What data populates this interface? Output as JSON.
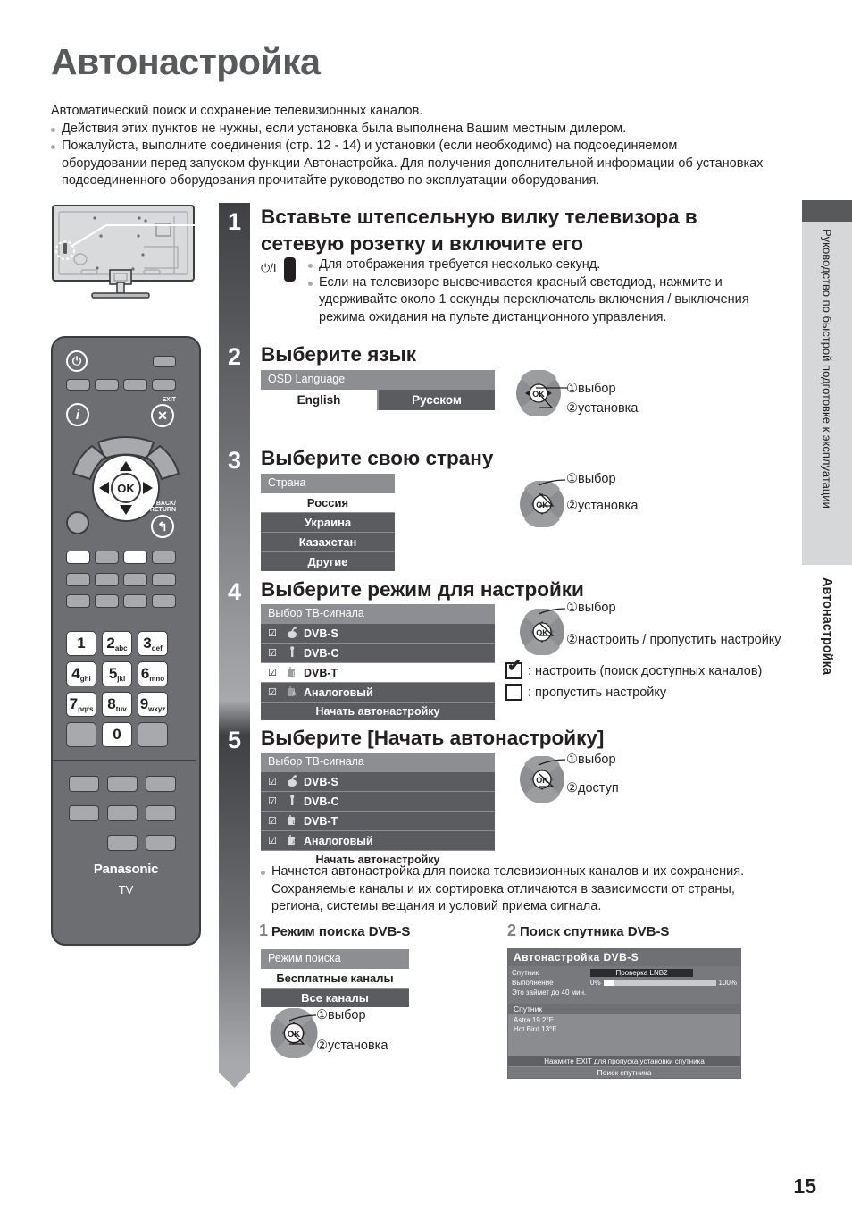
{
  "page": {
    "title": "Автонастройка",
    "number": "15"
  },
  "intro": {
    "lead": "Автоматический поиск и сохранение телевизионных каналов.",
    "bullets": [
      "Действия этих пунктов не нужны, если установка была выполнена Вашим местным дилером.",
      "Пожалуйста, выполните соединения (стр. 12 - 14) и установки (если необходимо) на подсоединяемом оборудовании перед запуском функции Автонастройка. Для получения дополнительной информации об установках подсоединенного оборудования прочитайте руководство по эксплуатации оборудования."
    ]
  },
  "steps": [
    {
      "num": "1",
      "heading": "Вставьте штепсельную вилку телевизора в сетевую розетку и включите его",
      "power_label": "⏻/I",
      "bullets": [
        "Для отображения требуется несколько секунд.",
        "Если на телевизоре высвечивается красный светодиод, нажмите и удерживайте около 1 секунды переключатель включения / выключения режима ожидания на пульте дистанционного управления."
      ]
    },
    {
      "num": "2",
      "heading": "Выберите язык",
      "osd": {
        "title": "OSD Language",
        "options": [
          "English",
          "Русском"
        ],
        "selected": "English"
      },
      "callouts": [
        "①выбор",
        "②установка"
      ],
      "wheel": "left-right"
    },
    {
      "num": "3",
      "heading": "Выберите свою страну",
      "osd": {
        "title": "Страна",
        "rows": [
          "Россия",
          "Украина",
          "Казахстан",
          "Другие"
        ],
        "selected": "Россия"
      },
      "callouts": [
        "①выбор",
        "②установка"
      ],
      "wheel": "up-down"
    },
    {
      "num": "4",
      "heading": "Выберите режим для настройки",
      "osd": {
        "title": "Выбор ТВ-сигнала",
        "rows": [
          {
            "label": "DVB-S",
            "checked": true,
            "icon": "satellite-icon"
          },
          {
            "label": "DVB-C",
            "checked": true,
            "icon": "cable-icon"
          },
          {
            "label": "DVB-T",
            "checked": true,
            "icon": "antenna-terrestrial-icon"
          },
          {
            "label": "Аналоговый",
            "checked": true,
            "icon": "antenna-analogue-icon"
          }
        ],
        "selected": "DVB-T",
        "start_label": "Начать автонастройку"
      },
      "callouts": [
        "①выбор",
        "②настроить / пропустить настройку"
      ],
      "wheel": "up-down",
      "legend": [
        {
          "state": "checked",
          "text": ": настроить (поиск доступных каналов)"
        },
        {
          "state": "empty",
          "text": ": пропустить настройку"
        }
      ]
    },
    {
      "num": "5",
      "heading": "Выберите [Начать автонастройку]",
      "osd": {
        "title": "Выбор ТВ-сигнала",
        "rows": [
          {
            "label": "DVB-S",
            "checked": true,
            "icon": "satellite-icon"
          },
          {
            "label": "DVB-C",
            "checked": true,
            "icon": "cable-icon"
          },
          {
            "label": "DVB-T",
            "checked": true,
            "icon": "antenna-terrestrial-icon"
          },
          {
            "label": "Аналоговый",
            "checked": true,
            "icon": "antenna-analogue-icon"
          }
        ],
        "selected": "Начать автонастройку",
        "start_label": "Начать автонастройку"
      },
      "callouts": [
        "①выбор",
        "②доступ"
      ],
      "wheel": "up-down"
    }
  ],
  "after_note": "Начнется автонастройка для поиска телевизионных каналов и их сохранения. Сохраняемые каналы и их сортировка отличаются в зависимости от страны, региона, системы вещания и условий приема сигнала.",
  "substeps": [
    {
      "num": "1",
      "title": "Режим поиска DVB-S"
    },
    {
      "num": "2",
      "title": "Поиск спутника DVB-S"
    }
  ],
  "search_mode": {
    "osd": {
      "title": "Режим поиска",
      "rows": [
        "Бесплатные каналы",
        "Все каналы"
      ],
      "selected": "Бесплатные каналы"
    },
    "callouts": [
      "①выбор",
      "②установка"
    ]
  },
  "dvbs_panel": {
    "title": "Автонастройка DVB-S",
    "satellite_label": "Спутник",
    "satellite_value": "Проверка LNB2",
    "progress_label": "Выполнение",
    "progress_min": "0%",
    "progress_max": "100%",
    "progress_percent": 9,
    "eta_note": "Это займет до 40 мин.",
    "list_header": "Спутник",
    "list_items": [
      "Astra 19.2°E",
      "Hot Bird 13°E"
    ],
    "footer_hint": "Нажмите EXIT для пропуска установки спутника",
    "footer_action": "Поиск спутника"
  },
  "side_tab": {
    "chapter": "Руководство по быстрой подготовке к эксплуатации",
    "section": "Автонастройка"
  },
  "remote": {
    "brand": "Panasonic",
    "device": "TV",
    "labels": {
      "exit": "EXIT",
      "back": "BACK/\nRETURN",
      "ok": "OK",
      "info": "i",
      "power": "⏻"
    },
    "numpad": [
      {
        "d": "1",
        "s": ""
      },
      {
        "d": "2",
        "s": "abc"
      },
      {
        "d": "3",
        "s": "def"
      },
      {
        "d": "4",
        "s": "ghi"
      },
      {
        "d": "5",
        "s": "jkl"
      },
      {
        "d": "6",
        "s": "mno"
      },
      {
        "d": "7",
        "s": "pqrs"
      },
      {
        "d": "8",
        "s": "tuv"
      },
      {
        "d": "9",
        "s": "wxyz"
      },
      {
        "d": "0",
        "s": ""
      }
    ]
  },
  "colors": {
    "accent_grey": "#8c8e91",
    "row_grey": "#5a5c60",
    "title_grey": "#58595b"
  }
}
